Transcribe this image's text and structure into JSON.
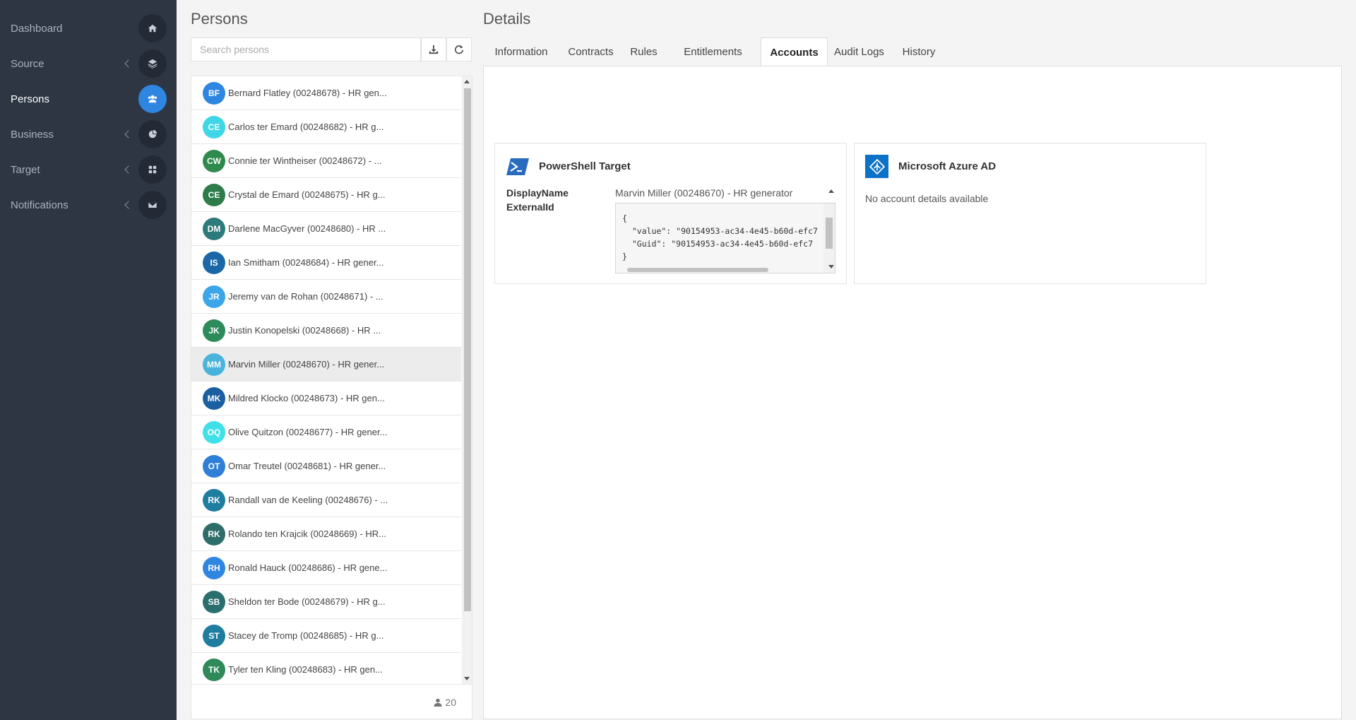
{
  "sidebar": {
    "items": [
      {
        "label": "Dashboard",
        "icon": "home-icon",
        "chevron": false,
        "active": false
      },
      {
        "label": "Source",
        "icon": "layers-icon",
        "chevron": true,
        "active": false
      },
      {
        "label": "Persons",
        "icon": "users-icon",
        "chevron": false,
        "active": true
      },
      {
        "label": "Business",
        "icon": "pie-chart-icon",
        "chevron": true,
        "active": false
      },
      {
        "label": "Target",
        "icon": "grid-icon",
        "chevron": true,
        "active": false
      },
      {
        "label": "Notifications",
        "icon": "envelope-icon",
        "chevron": true,
        "active": false
      }
    ]
  },
  "persons": {
    "title": "Persons",
    "search_placeholder": "Search persons",
    "count": "20",
    "list": [
      {
        "initials": "BF",
        "name": "Bernard Flatley (00248678) - HR gen...",
        "color": "#2f86e0"
      },
      {
        "initials": "CE",
        "name": "Carlos ter Emard (00248682) - HR g...",
        "color": "#3fd6e6"
      },
      {
        "initials": "CW",
        "name": "Connie ter Wintheiser (00248672) - ...",
        "color": "#2f8a4e"
      },
      {
        "initials": "CE",
        "name": "Crystal de Emard (00248675) - HR g...",
        "color": "#2d7c4a"
      },
      {
        "initials": "DM",
        "name": "Darlene MacGyver (00248680) - HR ...",
        "color": "#2d7a7c"
      },
      {
        "initials": "IS",
        "name": "Ian Smitham (00248684) - HR gener...",
        "color": "#1a67a8"
      },
      {
        "initials": "JR",
        "name": "Jeremy van de Rohan (00248671) - ...",
        "color": "#3aa5e8"
      },
      {
        "initials": "JK",
        "name": "Justin Konopelski (00248668) - HR ...",
        "color": "#2d8a5a"
      },
      {
        "initials": "MM",
        "name": "Marvin Miller (00248670) - HR gener...",
        "color": "#4ab3dc",
        "selected": true
      },
      {
        "initials": "MK",
        "name": "Mildred Klocko (00248673) - HR gen...",
        "color": "#1a5fa0"
      },
      {
        "initials": "OQ",
        "name": "Olive Quitzon (00248677) - HR gener...",
        "color": "#3fe0e8"
      },
      {
        "initials": "OT",
        "name": "Omar Treutel (00248681) - HR gener...",
        "color": "#2f7fd6"
      },
      {
        "initials": "RK",
        "name": "Randall van de Keeling (00248676) - ...",
        "color": "#1f7ea0"
      },
      {
        "initials": "RK",
        "name": "Rolando ten Krajcik (00248669) - HR...",
        "color": "#2e6e6a"
      },
      {
        "initials": "RH",
        "name": "Ronald Hauck (00248686) - HR gene...",
        "color": "#2f86e0"
      },
      {
        "initials": "SB",
        "name": "Sheldon ter Bode (00248679) - HR g...",
        "color": "#2a6e6e"
      },
      {
        "initials": "ST",
        "name": "Stacey de Tromp (00248685) - HR g...",
        "color": "#1f7ea0"
      },
      {
        "initials": "TK",
        "name": "Tyler ten Kling (00248683) - HR gen...",
        "color": "#2f8a5a"
      }
    ]
  },
  "details": {
    "title": "Details",
    "tabs": [
      {
        "label": "Information",
        "active": false
      },
      {
        "label": "Contracts",
        "active": false
      },
      {
        "label": "Rules",
        "active": false
      },
      {
        "label": "Entitlements",
        "active": false
      },
      {
        "label": "Accounts",
        "active": true
      },
      {
        "label": "Audit Logs",
        "active": false
      },
      {
        "label": "History",
        "active": false
      }
    ],
    "powershell": {
      "title": "PowerShell Target",
      "display_label": "DisplayName",
      "display_value": "Marvin Miller (00248670) - HR generator",
      "externalid_label": "ExternalId",
      "externalid_json": "{\n  \"value\": \"90154953-ac34-4e45-b60d-efc7\n  \"Guid\": \"90154953-ac34-4e45-b60d-efc7\n}"
    },
    "azure": {
      "title": "Microsoft Azure AD",
      "message": "No account details available"
    }
  },
  "colors": {
    "sidebar_bg": "#2e3644",
    "accent": "#2f86e0",
    "azure": "#0c72c7"
  }
}
